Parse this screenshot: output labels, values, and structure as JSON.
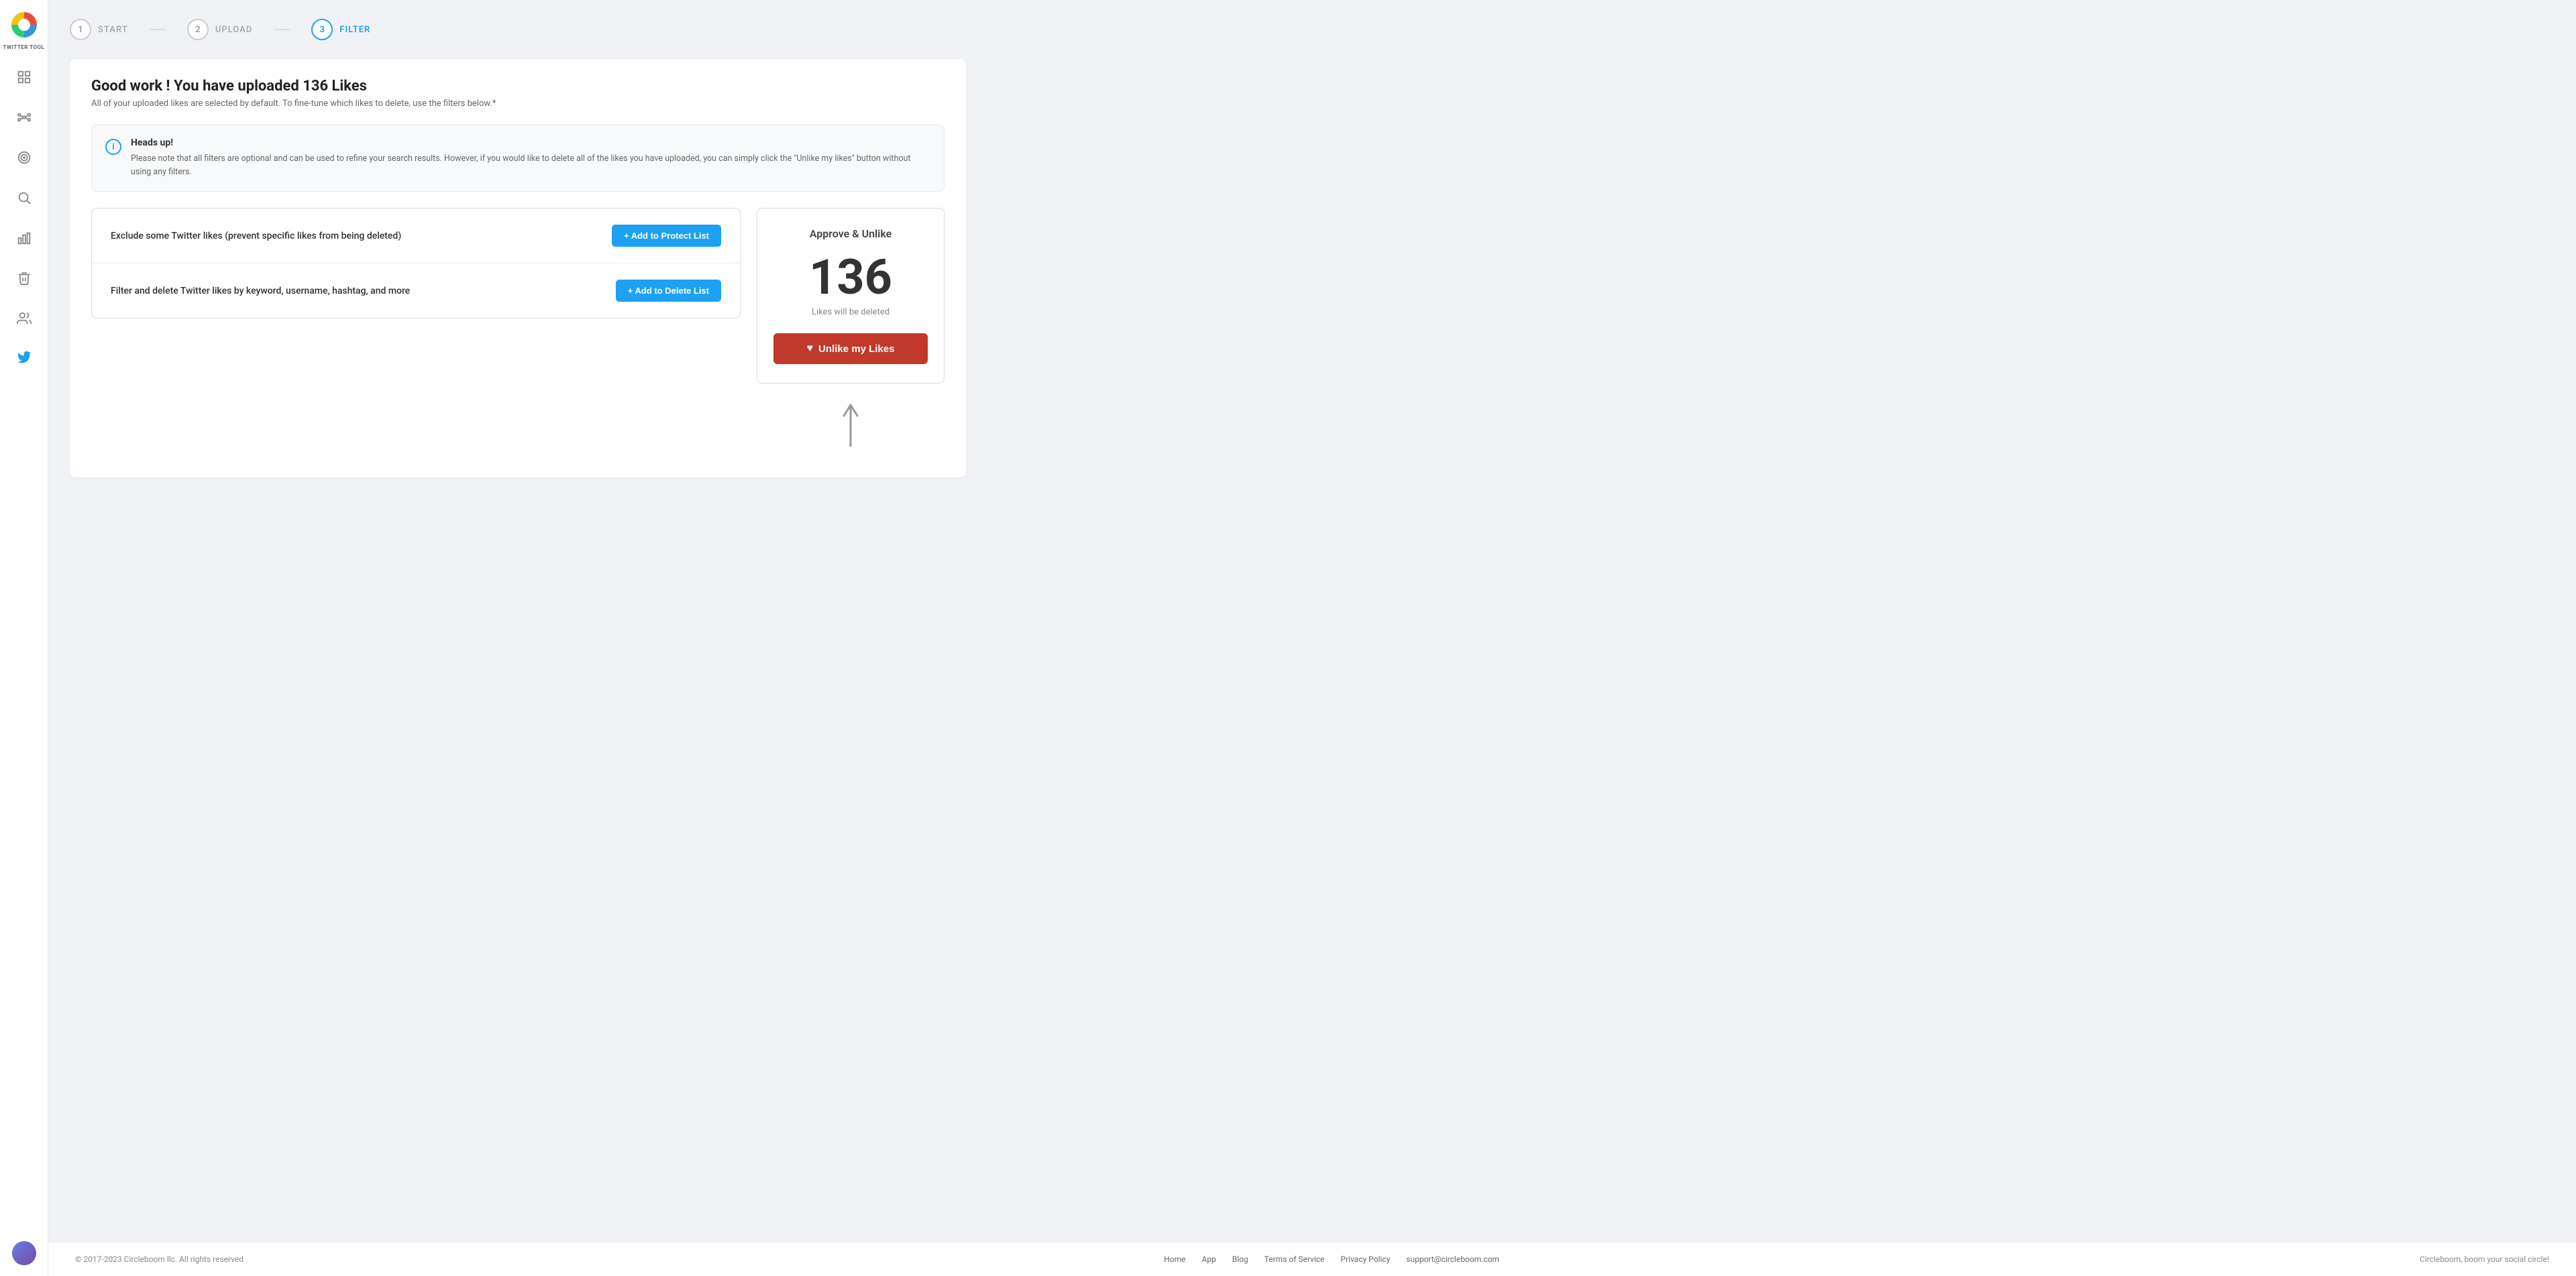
{
  "sidebar": {
    "app_label": "TWITTER TOOL",
    "nav_items": [
      {
        "name": "dashboard",
        "icon": "grid"
      },
      {
        "name": "network",
        "icon": "nodes"
      },
      {
        "name": "target",
        "icon": "circle"
      },
      {
        "name": "search",
        "icon": "search"
      },
      {
        "name": "analytics",
        "icon": "bar-chart"
      },
      {
        "name": "delete",
        "icon": "trash"
      },
      {
        "name": "users",
        "icon": "users"
      },
      {
        "name": "twitter",
        "icon": "twitter",
        "active": true
      }
    ]
  },
  "steps": [
    {
      "number": "1",
      "label": "START",
      "active": false
    },
    {
      "number": "2",
      "label": "UPLOAD",
      "active": false
    },
    {
      "number": "3",
      "label": "FILTER",
      "active": true
    }
  ],
  "page": {
    "title": "Good work ! You have uploaded 136 Likes",
    "subtitle": "All of your uploaded likes are selected by default. To fine-tune which likes to delete, use the filters below.*"
  },
  "notice": {
    "title": "Heads up!",
    "text": "Please note that all filters are optional and can be used to refine your search results. However, if you would like to delete all of the likes you have uploaded, you can simply click the \"Unlike my likes\" button without using any filters."
  },
  "filters": [
    {
      "label": "Exclude some Twitter likes (prevent specific likes from being deleted)",
      "button": "+ Add to Protect List"
    },
    {
      "label": "Filter and delete Twitter likes by keyword, username, hashtag, and more",
      "button": "+ Add to Delete List"
    }
  ],
  "approve": {
    "title": "Approve & Unlike",
    "count": "136",
    "description": "Likes will be deleted",
    "button_label": "Unlike my Likes"
  },
  "footer": {
    "copyright": "© 2017-2023 Circleboom llc. All rights reserved",
    "links": [
      {
        "label": "Home",
        "href": "#"
      },
      {
        "label": "App",
        "href": "#"
      },
      {
        "label": "Blog",
        "href": "#"
      },
      {
        "label": "Terms of Service",
        "href": "#"
      },
      {
        "label": "Privacy Policy",
        "href": "#"
      },
      {
        "label": "support@circleboom.com",
        "href": "#"
      }
    ],
    "tagline": "Circleboom, boom your social circle!"
  }
}
